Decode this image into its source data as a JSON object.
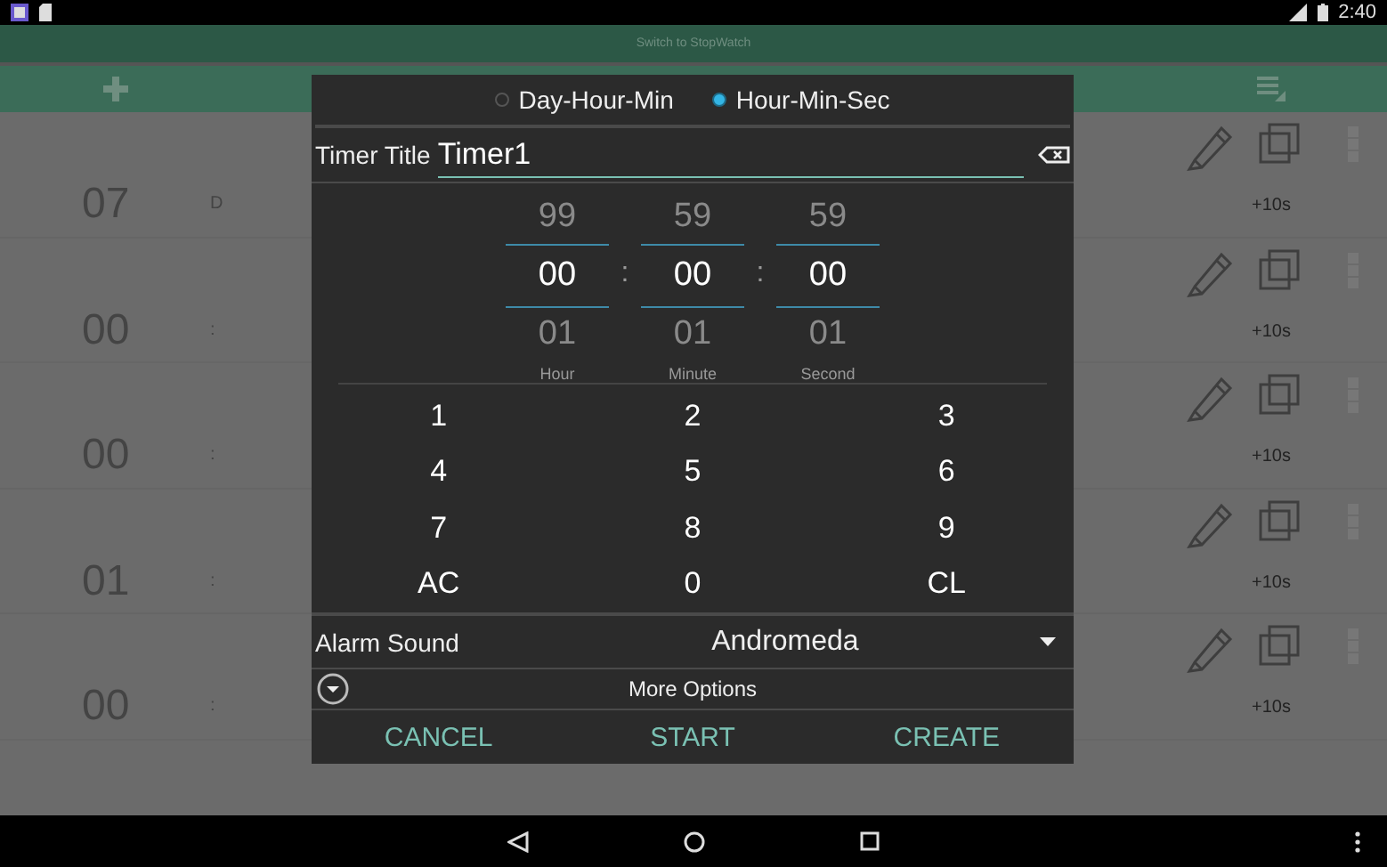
{
  "status_bar": {
    "time": "2:40"
  },
  "header": {
    "switch_label": "Switch to StopWatch"
  },
  "timers": [
    {
      "value": "07",
      "separator": "D",
      "bonus": "+10s"
    },
    {
      "value": "00",
      "separator": ":",
      "bonus": "+10s"
    },
    {
      "value": "00",
      "separator": ":",
      "bonus": "+10s"
    },
    {
      "value": "01",
      "separator": ":",
      "bonus": "+10s"
    },
    {
      "value": "00",
      "separator": ":",
      "bonus": "+10s"
    }
  ],
  "dialog": {
    "format_options": [
      {
        "label": "Day-Hour-Min",
        "selected": false
      },
      {
        "label": "Hour-Min-Sec",
        "selected": true
      }
    ],
    "title_label": "Timer Title",
    "title_value": "Timer1",
    "pickers": [
      {
        "above": "99",
        "value": "00",
        "below": "01",
        "label": "Hour"
      },
      {
        "above": "59",
        "value": "00",
        "below": "01",
        "label": "Minute"
      },
      {
        "above": "59",
        "value": "00",
        "below": "01",
        "label": "Second"
      }
    ],
    "picker_separator": ":",
    "keypad": [
      "1",
      "2",
      "3",
      "4",
      "5",
      "6",
      "7",
      "8",
      "9",
      "AC",
      "0",
      "CL"
    ],
    "alarm_label": "Alarm Sound",
    "alarm_value": "Andromeda",
    "more_options": "More Options",
    "buttons": [
      "CANCEL",
      "START",
      "CREATE"
    ]
  }
}
